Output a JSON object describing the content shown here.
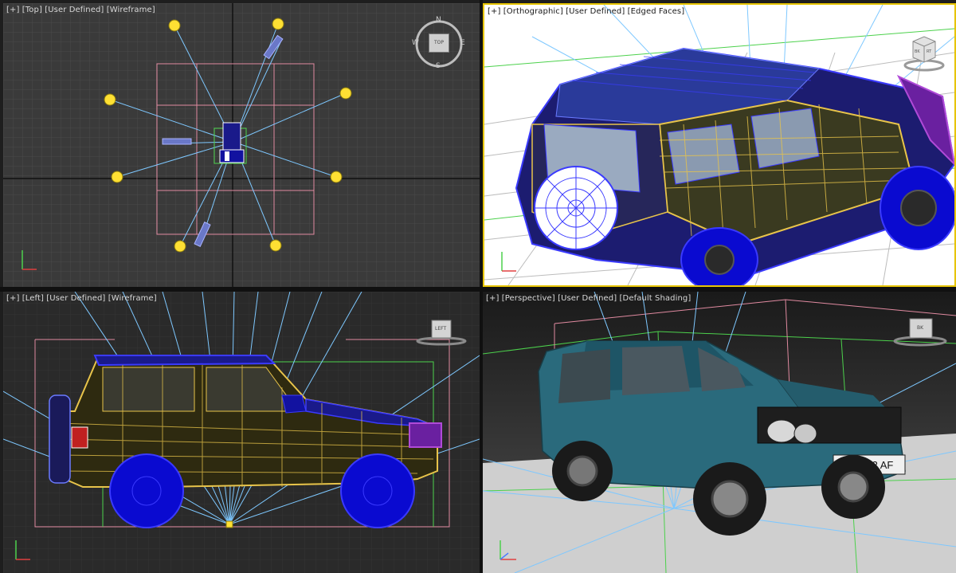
{
  "viewports": {
    "top": {
      "label_plus": "[+]",
      "label_view": "[Top]",
      "label_user": "[User Defined]",
      "label_mode": "[Wireframe]"
    },
    "ortho": {
      "label_plus": "[+]",
      "label_view": "[Orthographic]",
      "label_user": "[User Defined]",
      "label_mode": "[Edged Faces]"
    },
    "left": {
      "label_plus": "[+]",
      "label_view": "[Left]",
      "label_user": "[User Defined]",
      "label_mode": "[Wireframe]"
    },
    "persp": {
      "label_plus": "[+]",
      "label_view": "[Perspective]",
      "label_user": "[User Defined]",
      "label_mode": "[Default Shading]"
    }
  },
  "viewcube": {
    "top_face": "TOP",
    "ortho_face": "RT",
    "ortho_face_left": "BK",
    "left_face": "LEFT",
    "persp_face": "BK"
  },
  "compass": {
    "n": "N",
    "s": "S",
    "e": "E",
    "w": "W"
  },
  "license_plate": "S 4392 AF",
  "colors": {
    "wire_blue": "#3a3aff",
    "wire_yellow": "#e8c44a",
    "wire_purple": "#b04ad8",
    "light_rays": "#7ec8ff",
    "light_yellow": "#ffe033",
    "grid_pink": "#e08aa0",
    "grid_green": "#4cd14c",
    "car_teal": "#2a6a7c",
    "active_border": "#e6c400"
  },
  "icons": [
    "light-icon",
    "viewcube-icon",
    "compass-icon",
    "axis-tripod-icon",
    "wheel-icon"
  ]
}
